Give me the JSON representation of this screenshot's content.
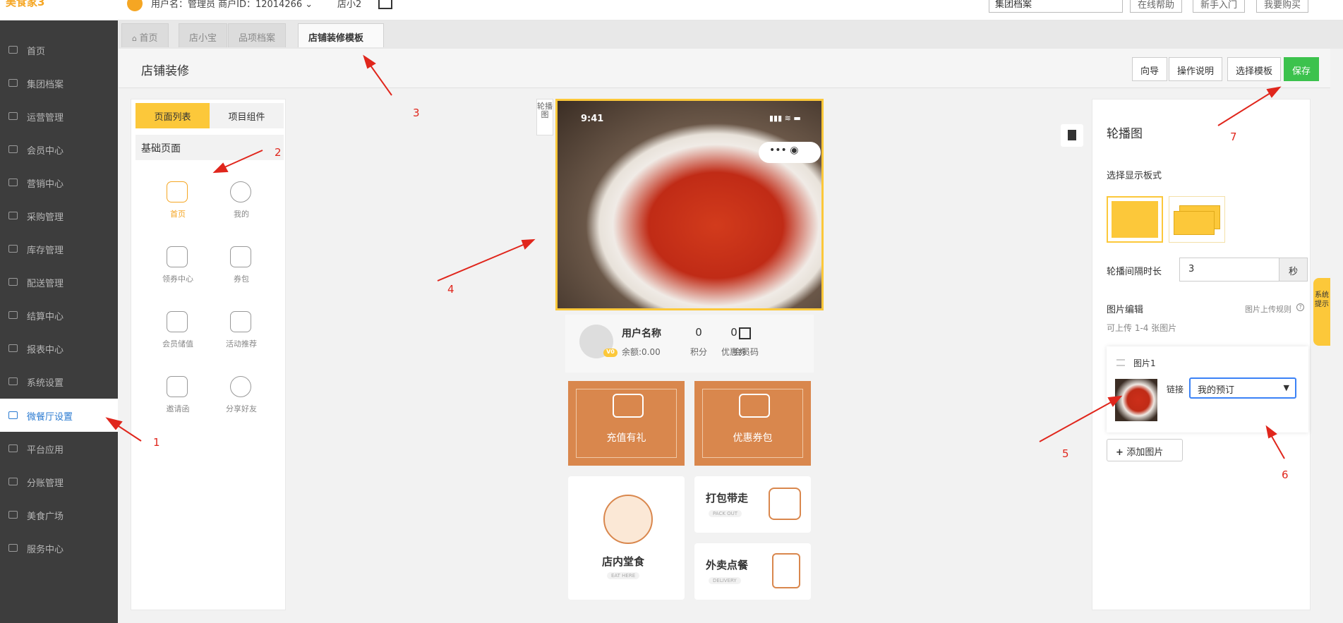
{
  "topbar": {
    "logo": "美食家3",
    "user_info": "用户名：管理员   商户ID：12014266 ⌄",
    "store_name": "店小2",
    "select_value": "集团档案",
    "buttons": [
      "在线帮助",
      "新手入门",
      "我要购买"
    ]
  },
  "sidebar": {
    "items": [
      {
        "label": "首页",
        "icon": "home-icon"
      },
      {
        "label": "集团档案",
        "icon": "document-icon"
      },
      {
        "label": "运营管理",
        "icon": "bar-chart-icon"
      },
      {
        "label": "会员中心",
        "icon": "id-card-icon"
      },
      {
        "label": "营销中心",
        "icon": "edit-icon"
      },
      {
        "label": "采购管理",
        "icon": "book-icon"
      },
      {
        "label": "库存管理",
        "icon": "clipboard-icon"
      },
      {
        "label": "配送管理",
        "icon": "truck-icon"
      },
      {
        "label": "结算中心",
        "icon": "bitcoin-icon"
      },
      {
        "label": "报表中心",
        "icon": "report-icon"
      },
      {
        "label": "系统设置",
        "icon": "gears-icon"
      },
      {
        "label": "微餐厅设置",
        "icon": "cutlery-icon",
        "active": true
      },
      {
        "label": "平台应用",
        "icon": "compass-icon"
      },
      {
        "label": "分账管理",
        "icon": "circle-arrow-icon"
      },
      {
        "label": "美食广场",
        "icon": "bowl-icon"
      },
      {
        "label": "服务中心",
        "icon": "check-square-icon"
      }
    ]
  },
  "tabs": [
    {
      "label": "首页",
      "icon": "home-icon"
    },
    {
      "label": "店小宝"
    },
    {
      "label": "品项档案"
    },
    {
      "label": "店铺装修模板",
      "active": true
    }
  ],
  "header": {
    "title": "店铺装修",
    "buttons": {
      "guide": "向导",
      "instructions": "操作说明",
      "choose_template": "选择模板",
      "save": "保存"
    }
  },
  "left_panel": {
    "tabs": {
      "pages": "页面列表",
      "components": "项目组件"
    },
    "section_title": "基础页面",
    "pages": [
      {
        "label": "首页",
        "icon": "home-icon",
        "active": true
      },
      {
        "label": "我的",
        "icon": "user-icon"
      },
      {
        "label": "领券中心",
        "icon": "coupon-center-icon"
      },
      {
        "label": "券包",
        "icon": "coupon-pack-icon"
      },
      {
        "label": "会员储值",
        "icon": "wallet-icon"
      },
      {
        "label": "活动推荐",
        "icon": "gift-icon"
      },
      {
        "label": "邀请函",
        "icon": "envelope-icon"
      },
      {
        "label": "分享好友",
        "icon": "share-icon"
      }
    ]
  },
  "phone": {
    "carousel_tag": "轮播图",
    "status_time": "9:41",
    "status_icons": "▮▮▮ ≋ ▬",
    "capsule": "••• ◉",
    "member": {
      "name": "用户名称",
      "balance": "余额:0.00",
      "vip": "V0",
      "points_value": "0",
      "points_label": "积分",
      "coupons_value": "0",
      "coupons_label": "优惠券",
      "code_label": "会员码"
    },
    "promos": {
      "recharge": "充值有礼",
      "coupon_pack": "优惠券包"
    },
    "services": {
      "dinein_title": "店内堂食",
      "dinein_sub": "EAT HERE",
      "pack_title": "打包带走",
      "pack_sub": "PACK OUT",
      "delivery_title": "外卖点餐",
      "delivery_sub": "DELIVERY"
    }
  },
  "right_panel": {
    "title": "轮播图",
    "display_label": "选择显示板式",
    "interval_label": "轮播间隔时长",
    "interval_value": "3",
    "interval_unit": "秒",
    "image_edit_label": "图片编辑",
    "upload_rule": "图片上传规则",
    "upload_hint": "可上传 1-4 张图片",
    "image_card": {
      "title": "图片1",
      "link_label": "链接",
      "link_value": "我的预订"
    },
    "add_image": "添加图片"
  },
  "system_tip": "系统提示",
  "annotations": [
    "1",
    "2",
    "3",
    "4",
    "5",
    "6",
    "7"
  ],
  "colors": {
    "accent": "#fcc83a",
    "save": "#3cc24d",
    "sidebar": "#3d3d3d",
    "promo": "#d9874d",
    "annotation": "#e0261c"
  }
}
